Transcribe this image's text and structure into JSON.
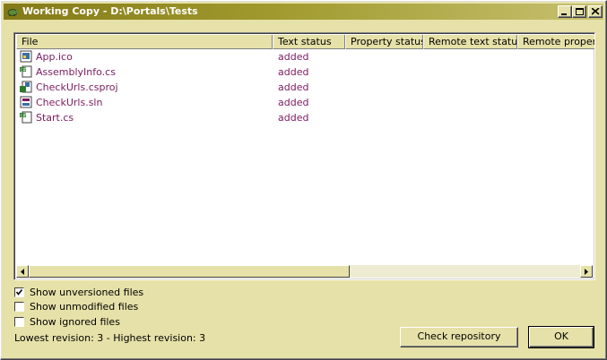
{
  "window": {
    "title": "Working Copy - D:\\Portals\\Tests"
  },
  "columns": [
    "File",
    "Text status",
    "Property status",
    "Remote text status",
    "Remote property"
  ],
  "files": [
    {
      "name": "App.ico",
      "status": "added",
      "icon": "image-file-icon"
    },
    {
      "name": "AssemblyInfo.cs",
      "status": "added",
      "icon": "csharp-file-icon"
    },
    {
      "name": "CheckUrls.csproj",
      "status": "added",
      "icon": "project-file-icon"
    },
    {
      "name": "CheckUrls.sln",
      "status": "added",
      "icon": "solution-file-icon"
    },
    {
      "name": "Start.cs",
      "status": "added",
      "icon": "csharp-file-icon"
    }
  ],
  "options": {
    "show_unversioned": {
      "label": "Show unversioned files",
      "checked": true
    },
    "show_unmodified": {
      "label": "Show unmodified files",
      "checked": false
    },
    "show_ignored": {
      "label": "Show ignored files",
      "checked": false
    }
  },
  "revision_info": "Lowest revision: 3 - Highest revision: 3",
  "buttons": {
    "check_repository": "Check repository",
    "ok": "OK"
  },
  "colors": {
    "accent_title": "#847A18",
    "window_bg": "#E6E1A8",
    "file_text": "#7B1A60"
  }
}
